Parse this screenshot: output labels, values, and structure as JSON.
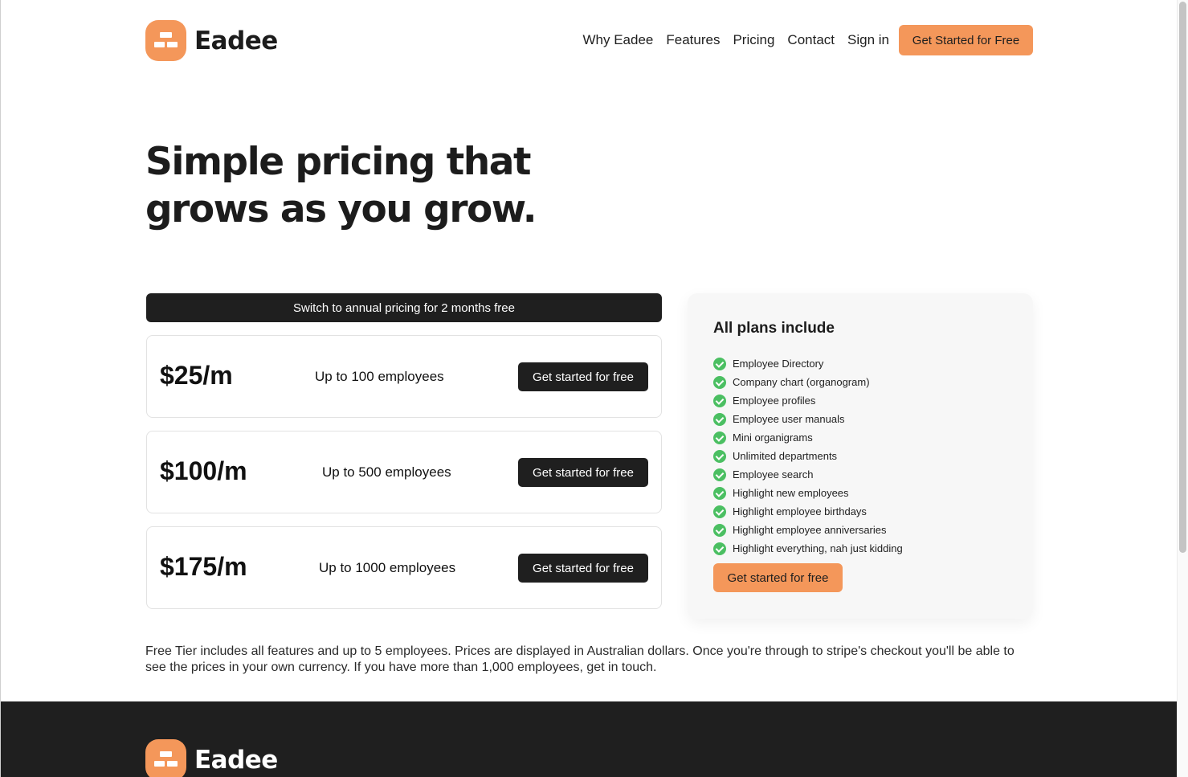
{
  "brand": {
    "name": "Eadee",
    "icon": "eadee-logo-icon",
    "accent_color": "#f4975a"
  },
  "nav": {
    "links": [
      "Why Eadee",
      "Features",
      "Pricing",
      "Contact",
      "Sign in"
    ],
    "cta": "Get Started for Free"
  },
  "hero": {
    "title": "Simple pricing that grows as you grow."
  },
  "pricing": {
    "switch_label": "Switch to annual pricing for 2 months free",
    "plans": [
      {
        "price": "$25/m",
        "description": "Up to 100 employees",
        "button": "Get started for free"
      },
      {
        "price": "$100/m",
        "description": "Up to 500 employees",
        "button": "Get started for free"
      },
      {
        "price": "$175/m",
        "description": "Up to 1000 employees",
        "button": "Get started for free"
      }
    ]
  },
  "features": {
    "title": "All plans include",
    "items": [
      "Employee Directory",
      "Company chart (organogram)",
      "Employee profiles",
      "Employee user manuals",
      "Mini organigrams",
      "Unlimited departments",
      "Employee search",
      "Highlight new employees",
      "Highlight employee birthdays",
      "Highlight employee anniversaries",
      "Highlight everything, nah just kidding"
    ],
    "check_icon": "check-circle-icon",
    "check_color": "#4bbf62",
    "button": "Get started for free"
  },
  "note": "Free Tier includes all features and up to 5 employees. Prices are displayed in Australian dollars. Once you're through to stripe's checkout you'll be able to see the prices in your own currency. If you have more than 1,000 employees, get in touch.",
  "footer": {
    "brand_name": "Eadee"
  }
}
